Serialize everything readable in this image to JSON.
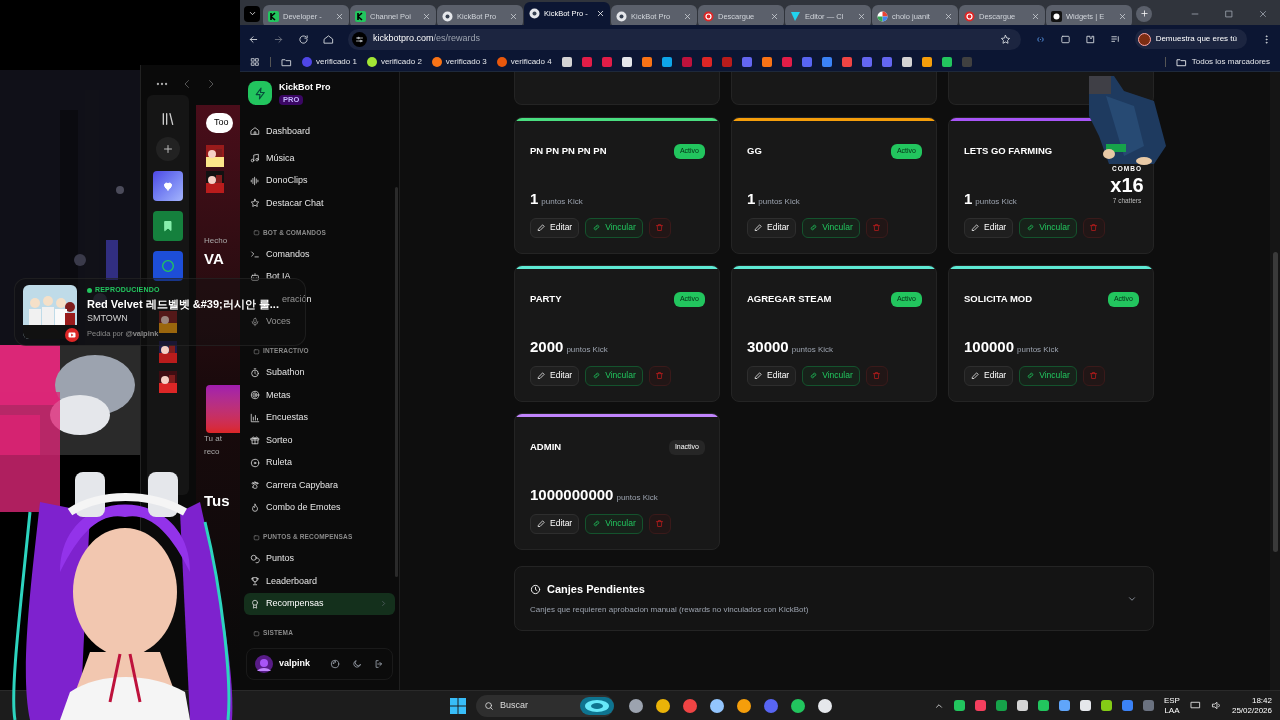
{
  "desktop_app": {
    "texts": [
      "Too",
      "Hecho",
      "VA",
      "Tu at",
      "reco",
      "Tus"
    ]
  },
  "browser": {
    "tabs": [
      {
        "title": "Developer - ",
        "selected": false
      },
      {
        "title": "Channel Poi",
        "selected": false
      },
      {
        "title": "KickBot Pro",
        "selected": false
      },
      {
        "title": "KickBot Pro -",
        "selected": true
      },
      {
        "title": "KickBot Pro",
        "selected": false
      },
      {
        "title": "Descargue ",
        "selected": false
      },
      {
        "title": "Editor — Cl",
        "selected": false
      },
      {
        "title": "cholo juanit",
        "selected": false
      },
      {
        "title": "Descargue ",
        "selected": false
      },
      {
        "title": "Widgets | E",
        "selected": false
      }
    ],
    "url_host": "kickbotpro.com",
    "url_path": "/es/rewards",
    "profile": "Demuestra que eres tú",
    "bookmarks": [
      {
        "label": "verificado 1",
        "color": "#4f46e5"
      },
      {
        "label": "verificado 2",
        "color": "#a3e635"
      },
      {
        "label": "verificado 3",
        "color": "#f97316"
      },
      {
        "label": "verificado 4",
        "color": "#ea580c"
      }
    ],
    "icon_bookmarks": [
      {
        "color": "#d4d4d4"
      },
      {
        "color": "#e11d48"
      },
      {
        "color": "#e11d48"
      },
      {
        "color": "#e5e7eb"
      },
      {
        "color": "#f97316"
      },
      {
        "color": "#0ea5e9"
      },
      {
        "color": "#be123c"
      },
      {
        "color": "#dc2626"
      },
      {
        "color": "#b91c1c"
      },
      {
        "color": "#6366f1"
      },
      {
        "color": "#f97316"
      },
      {
        "color": "#e11d48"
      },
      {
        "color": "#5865f2"
      },
      {
        "color": "#3b82f6"
      },
      {
        "color": "#ef4444"
      },
      {
        "color": "#6366f1"
      },
      {
        "color": "#6366f1"
      },
      {
        "color": "#d4d4d4"
      },
      {
        "color": "#f59e0b"
      },
      {
        "color": "#22c55e"
      },
      {
        "color": "#404040"
      }
    ],
    "all_bookmarks": "Todos los marcadores"
  },
  "sidebar": {
    "brand": "KickBot Pro",
    "badge": "PRO",
    "groups": [
      {
        "items": [
          {
            "label": "Dashboard",
            "kind": "item",
            "selected": false
          },
          {
            "label": "Música",
            "kind": "item",
            "selected": false
          },
          {
            "label": "DonoClips",
            "kind": "item",
            "selected": false
          },
          {
            "label": "Destacar Chat",
            "kind": "item",
            "selected": false
          }
        ]
      },
      {
        "title": "BOT & COMANDOS",
        "items": [
          {
            "label": "Comandos",
            "kind": "item",
            "selected": false
          },
          {
            "label": "Bot IA",
            "kind": "item",
            "selected": false
          },
          {
            "label": "eración",
            "kind": "covered",
            "selected": false
          },
          {
            "label": "Voces",
            "kind": "item",
            "selected": false
          }
        ]
      },
      {
        "title": "INTERACTIVO",
        "items": [
          {
            "label": "Subathon",
            "kind": "item",
            "selected": false
          },
          {
            "label": "Metas",
            "kind": "item",
            "selected": false
          },
          {
            "label": "Encuestas",
            "kind": "item",
            "selected": false
          },
          {
            "label": "Sorteo",
            "kind": "item",
            "selected": false
          },
          {
            "label": "Ruleta",
            "kind": "item",
            "selected": false
          },
          {
            "label": "Carrera Capybara",
            "kind": "item",
            "selected": false
          },
          {
            "label": "Combo de Emotes",
            "kind": "item",
            "selected": false
          }
        ]
      },
      {
        "title": "PUNTOS & RECOMPENSAS",
        "items": [
          {
            "label": "Puntos",
            "kind": "item",
            "selected": false
          },
          {
            "label": "Leaderboard",
            "kind": "item",
            "selected": false
          },
          {
            "label": "Recompensas",
            "kind": "item",
            "selected": true
          }
        ]
      },
      {
        "title": "SISTEMA"
      }
    ],
    "user": "valpink"
  },
  "cards": [
    {
      "title": "PN PN PN PN PN",
      "status": "Activo",
      "active": true,
      "points": "1",
      "unit": "puntos Kick",
      "color": "#4ade80",
      "edit": "Editar",
      "link": "Vincular"
    },
    {
      "title": "GG",
      "status": "Activo",
      "active": true,
      "points": "1",
      "unit": "puntos Kick",
      "color": "#f59e0b",
      "edit": "Editar",
      "link": "Vincular"
    },
    {
      "title": "LETS GO FARMING",
      "points": "1",
      "unit": "puntos Kick",
      "color": "#a855f7",
      "edit": "Editar",
      "link": "Vincular"
    },
    {
      "title": "PARTY",
      "status": "Activo",
      "active": true,
      "points": "2000",
      "unit": "puntos Kick",
      "color": "#5eead4",
      "edit": "Editar",
      "link": "Vincular"
    },
    {
      "title": "AGREGAR STEAM",
      "status": "Activo",
      "active": true,
      "points": "30000",
      "unit": "puntos Kick",
      "color": "#5eead4",
      "edit": "Editar",
      "link": "Vincular"
    },
    {
      "title": "SOLICITA MOD",
      "status": "Activo",
      "active": true,
      "points": "100000",
      "unit": "puntos Kick",
      "color": "#5eead4",
      "edit": "Editar",
      "link": "Vincular"
    },
    {
      "title": "ADMIN",
      "status": "Inactivo",
      "active": false,
      "points": "1000000000",
      "unit": "puntos Kick",
      "color": "#c084fc",
      "edit": "Editar",
      "link": "Vincular"
    }
  ],
  "pending": {
    "title": "Canjes Pendientes",
    "subtitle": "Canjes que requieren aprobacion manual (rewards no vinculados con KickBot)",
    "expanded": false
  },
  "now_playing": {
    "status": "REPRODUCIENDO",
    "title": "Red Velvet 레드벨벳 &#39;러시안 룰...",
    "artist": "SMTOWN",
    "requested_by": "Pedida por **@valpink**"
  },
  "combo": {
    "label": "COMBO",
    "count": "x16",
    "chatters": "7 chatters"
  },
  "taskbar": {
    "search": "Buscar",
    "lang": "ESP",
    "layout": "LAA",
    "time": "18:42",
    "date": "25/02/2026"
  }
}
